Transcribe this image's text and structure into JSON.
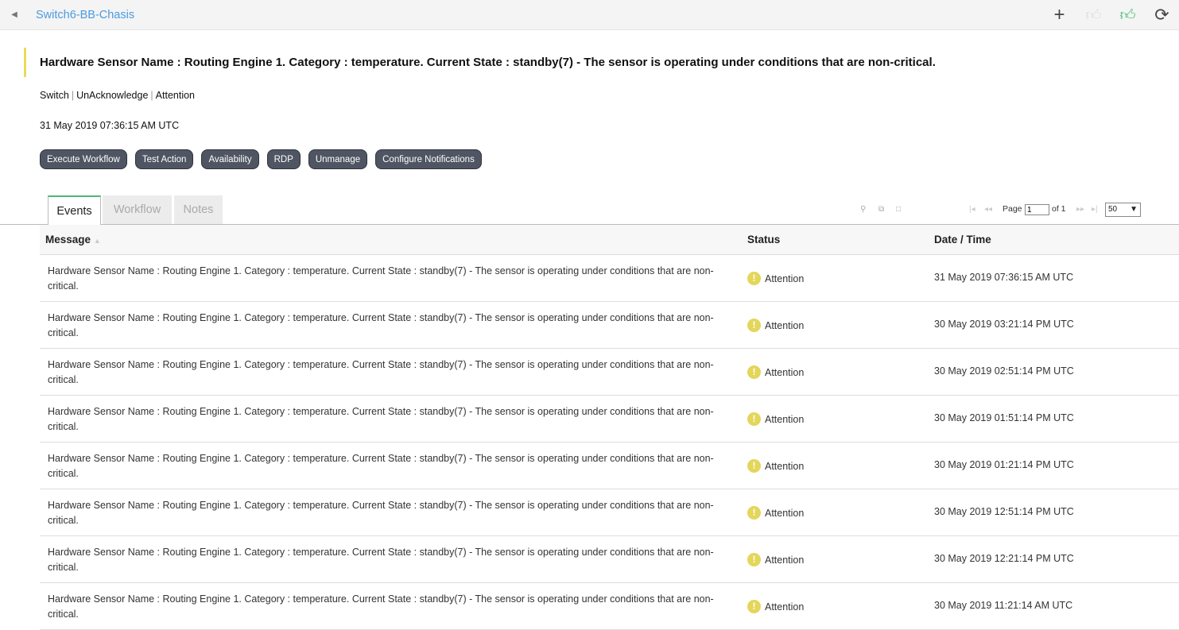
{
  "header": {
    "breadcrumb": "Switch6-BB-Chasis",
    "back_icon": "◂",
    "icons": {
      "add": "+",
      "like": "👍",
      "liked": "👍",
      "refresh": "⟳"
    }
  },
  "alarm": {
    "title": "Hardware Sensor Name : Routing Engine 1. Category : temperature. Current State : standby(7) - The sensor is operating under conditions that are non-critical.",
    "category": "Switch",
    "ack": "UnAcknowledge",
    "severity": "Attention",
    "datetime": "31 May 2019 07:36:15 AM UTC"
  },
  "actions": [
    "Execute Workflow",
    "Test Action",
    "Availability",
    "RDP",
    "Unmanage",
    "Configure Notifications"
  ],
  "tabs": [
    "Events",
    "Workflow",
    "Notes"
  ],
  "pager": {
    "page_label": "Page",
    "page": "1",
    "of_label": "of 1",
    "per_page": "50"
  },
  "table": {
    "columns": [
      "Message",
      "Status",
      "Date / Time"
    ],
    "rows": [
      {
        "message": "Hardware Sensor Name : Routing Engine 1. Category : temperature. Current State : standby(7) - The sensor is operating under conditions that are non-critical.",
        "status": "Attention",
        "datetime": "31 May 2019 07:36:15 AM UTC"
      },
      {
        "message": "Hardware Sensor Name : Routing Engine 1. Category : temperature. Current State : standby(7) - The sensor is operating under conditions that are non-critical.",
        "status": "Attention",
        "datetime": "30 May 2019 03:21:14 PM UTC"
      },
      {
        "message": "Hardware Sensor Name : Routing Engine 1. Category : temperature. Current State : standby(7) - The sensor is operating under conditions that are non-critical.",
        "status": "Attention",
        "datetime": "30 May 2019 02:51:14 PM UTC"
      },
      {
        "message": "Hardware Sensor Name : Routing Engine 1. Category : temperature. Current State : standby(7) - The sensor is operating under conditions that are non-critical.",
        "status": "Attention",
        "datetime": "30 May 2019 01:51:14 PM UTC"
      },
      {
        "message": "Hardware Sensor Name : Routing Engine 1. Category : temperature. Current State : standby(7) - The sensor is operating under conditions that are non-critical.",
        "status": "Attention",
        "datetime": "30 May 2019 01:21:14 PM UTC"
      },
      {
        "message": "Hardware Sensor Name : Routing Engine 1. Category : temperature. Current State : standby(7) - The sensor is operating under conditions that are non-critical.",
        "status": "Attention",
        "datetime": "30 May 2019 12:51:14 PM UTC"
      },
      {
        "message": "Hardware Sensor Name : Routing Engine 1. Category : temperature. Current State : standby(7) - The sensor is operating under conditions that are non-critical.",
        "status": "Attention",
        "datetime": "30 May 2019 12:21:14 PM UTC"
      },
      {
        "message": "Hardware Sensor Name : Routing Engine 1. Category : temperature. Current State : standby(7) - The sensor is operating under conditions that are non-critical.",
        "status": "Attention",
        "datetime": "30 May 2019 11:21:14 AM UTC"
      }
    ]
  }
}
